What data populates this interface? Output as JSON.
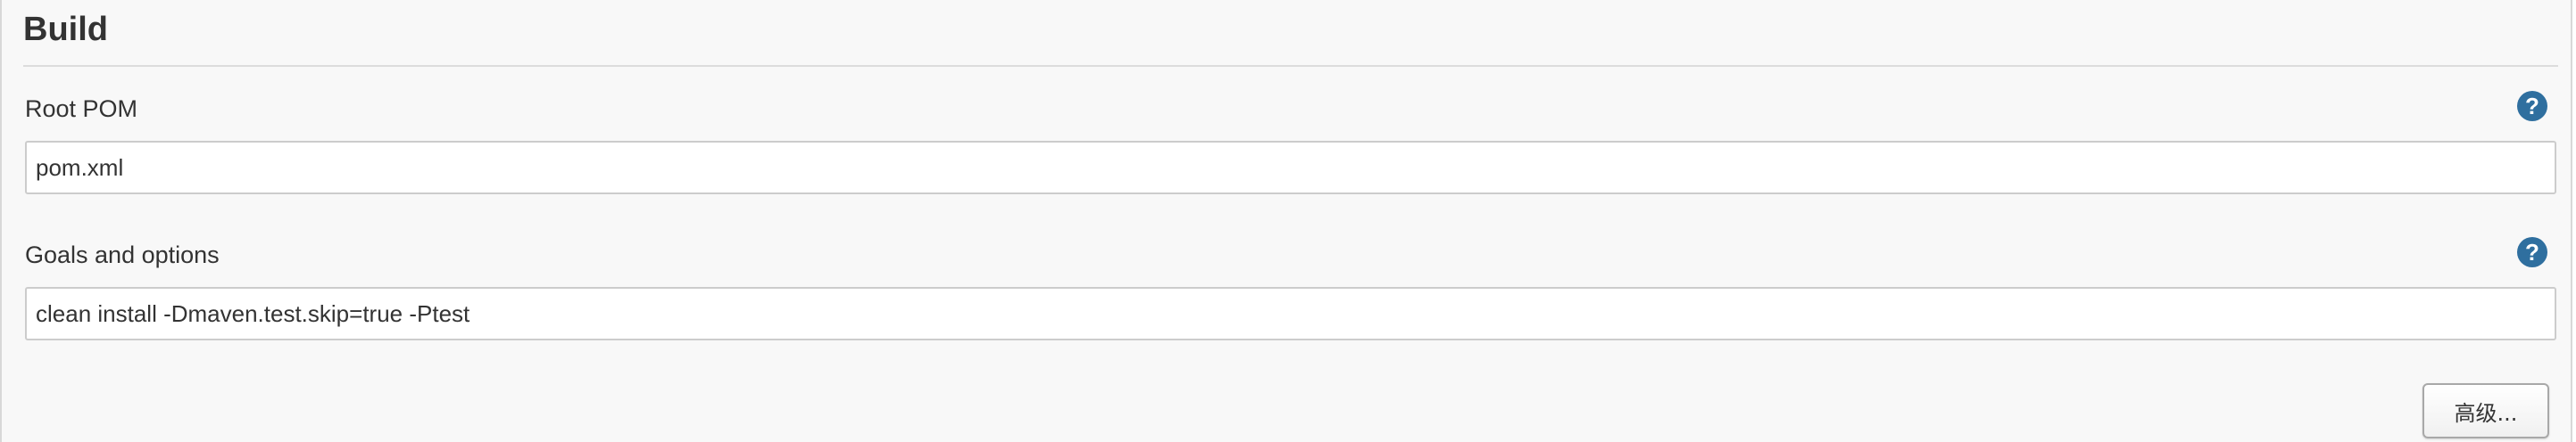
{
  "section": {
    "title": "Build"
  },
  "fields": [
    {
      "label": "Root POM",
      "value": "pom.xml",
      "help_icon": "question-mark-icon"
    },
    {
      "label": "Goals and options",
      "value": "clean install -Dmaven.test.skip=true -Ptest",
      "help_icon": "question-mark-icon"
    }
  ],
  "help_glyph": "?",
  "advanced_button": {
    "label": "高级..."
  },
  "colors": {
    "help_icon": "#2f6f9f",
    "panel_background": "#f8f8f8"
  }
}
